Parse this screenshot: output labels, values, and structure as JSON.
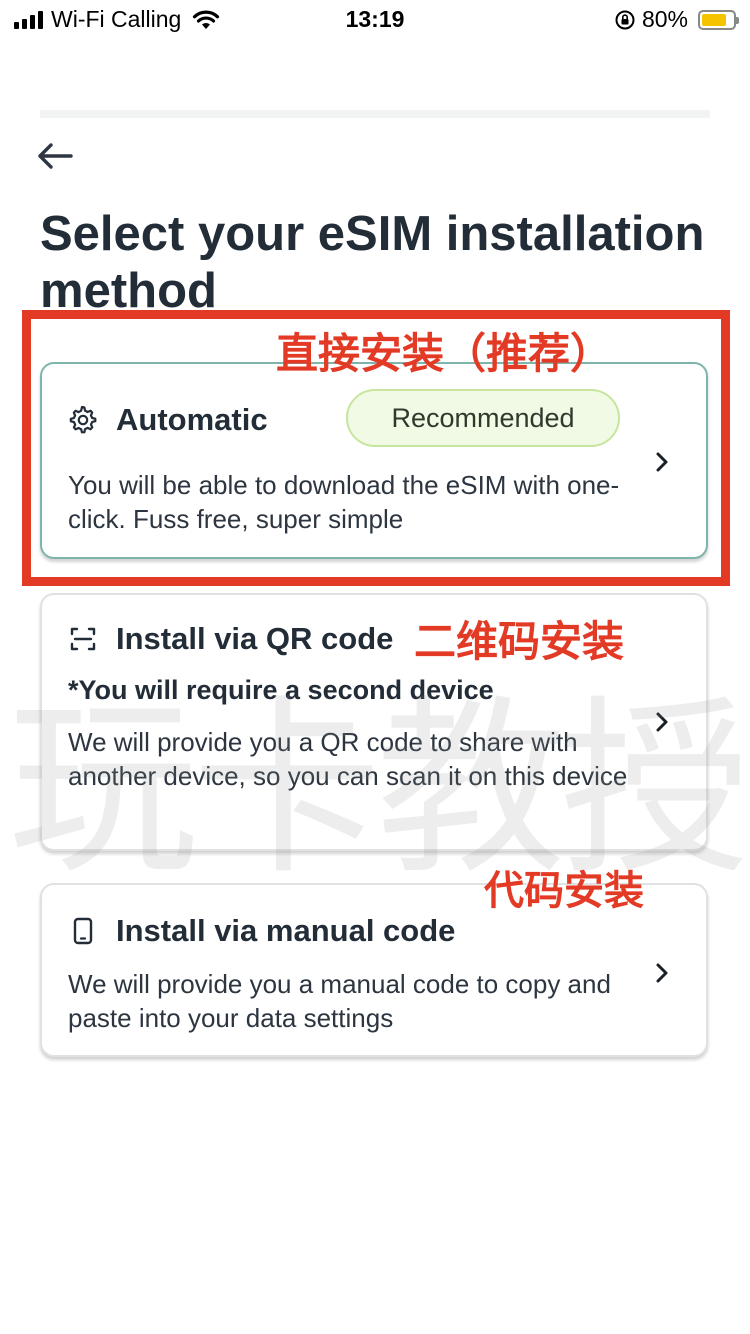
{
  "status_bar": {
    "carrier": "Wi-Fi Calling",
    "time": "13:19",
    "battery_percent": "80%",
    "battery_level": 0.8,
    "battery_color": "#f5c400"
  },
  "nav": {
    "back_icon": "arrow-left-icon"
  },
  "page": {
    "title": "Select your eSIM installation method"
  },
  "options": [
    {
      "icon": "gear-icon",
      "title": "Automatic",
      "badge": "Recommended",
      "description": "You will be able to download the eSIM with one-click. Fuss free, super simple"
    },
    {
      "icon": "qr-scan-icon",
      "title": "Install via QR code",
      "note": "*You will require a second device",
      "description": "We will provide you a QR code to share with another device, so you can scan it on this device"
    },
    {
      "icon": "phone-icon",
      "title": "Install via manual code",
      "description": "We will provide you a manual code to copy and paste into your data settings"
    }
  ],
  "annotations": {
    "automatic": "直接安装（推荐）",
    "qr": "二维码安装",
    "manual": "代码安装",
    "color": "#e33a26"
  },
  "watermark": "玩卡教授"
}
